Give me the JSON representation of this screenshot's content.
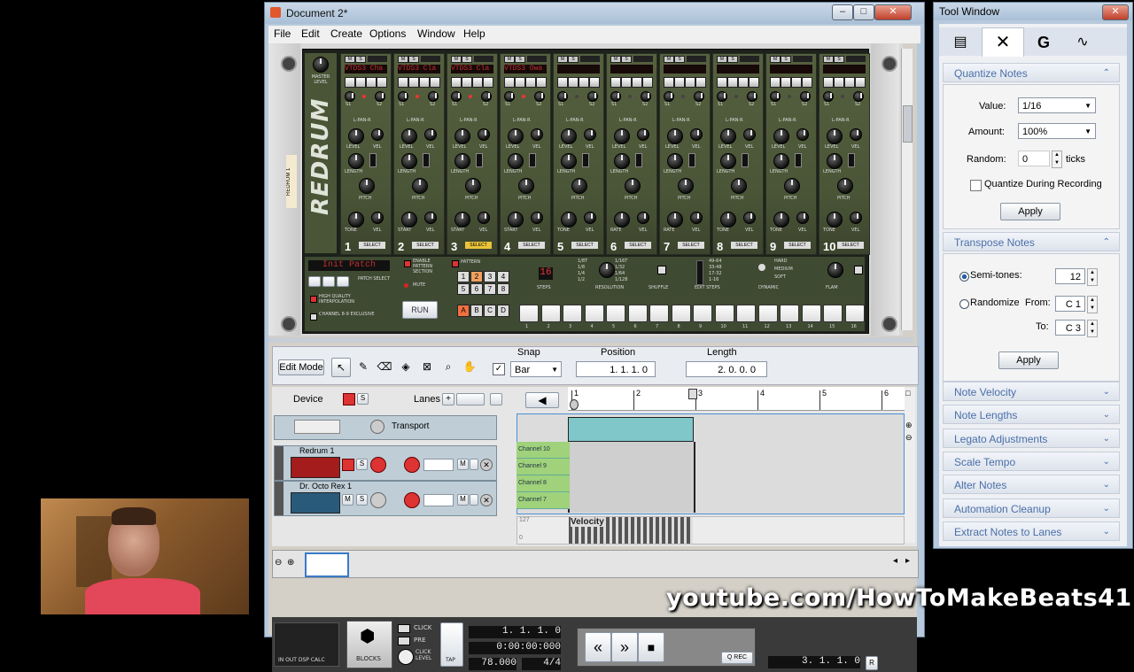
{
  "main_window": {
    "title": "Document 2*",
    "menu": [
      "File",
      "Edit",
      "Create",
      "Options",
      "Window",
      "Help"
    ]
  },
  "redrum": {
    "brand": "REDRUM",
    "device_label": "REDRUM 1",
    "master_label": "MASTER LEVEL",
    "channel_names": [
      "VTDS3 Cha",
      "VTDS3 Cla",
      "VTDS3 Cla",
      "VTDS3 Owa",
      "",
      "",
      "",
      "",
      "",
      ""
    ],
    "channel_numbers": [
      "1",
      "2",
      "3",
      "4",
      "5",
      "6",
      "7",
      "8",
      "9",
      "10"
    ],
    "select_label": "SELECT",
    "knob_labels": {
      "pan": "L-PAN-R",
      "level": "LEVEL",
      "vel": "VEL",
      "length": "LENGTH",
      "pitch": "PITCH",
      "tone": "TONE",
      "start": "START",
      "rate": "RATE",
      "bend": "BEND",
      "s1": "S1",
      "s2": "S2"
    },
    "patch_name": "Init Patch",
    "patch_select": "PATCH SELECT",
    "high_quality": "HIGH QUALITY INTERPOLATION",
    "channel_exclusive": "CHANNEL 8-9 EXCLUSIVE",
    "enable_pattern": "ENABLE PATTERN SECTION",
    "mute": "MUTE",
    "run": "RUN",
    "pattern_label": "PATTERN",
    "pattern_numbers": [
      "1",
      "2",
      "3",
      "4",
      "5",
      "6",
      "7",
      "8"
    ],
    "bank_letters": [
      "A",
      "B",
      "C",
      "D"
    ],
    "steps_value": "16",
    "steps_label": "STEPS",
    "resolution_label": "RESOLUTION",
    "resolution_options": [
      "1/8T",
      "1/8",
      "1/4",
      "1/2",
      "1/16T",
      "1/32",
      "1/64",
      "1/128"
    ],
    "shuffle_label": "SHUFFLE",
    "edit_steps_label": "EDIT STEPS",
    "edit_steps_options": [
      "49-64",
      "33-48",
      "17-32",
      "1-16"
    ],
    "dynamic_label": "DYNAMIC",
    "dynamic_options": [
      "HARD",
      "MEDIUM",
      "SOFT"
    ],
    "flam_label": "FLAM",
    "step_numbers": [
      "1",
      "2",
      "3",
      "4",
      "5",
      "6",
      "7",
      "8",
      "9",
      "10",
      "11",
      "12",
      "13",
      "14",
      "15",
      "16"
    ]
  },
  "sequencer": {
    "edit_mode": "Edit Mode",
    "snap_label": "Snap",
    "snap_value": "Bar",
    "position_label": "Position",
    "position_value": "1. 1. 1.   0",
    "length_label": "Length",
    "length_value": "2. 0. 0.   0",
    "device_label": "Device",
    "lanes_label": "Lanes",
    "ruler": [
      "1",
      "2",
      "3",
      "4",
      "5",
      "6"
    ],
    "tracks": [
      "Transport",
      "Redrum 1",
      "Dr. Octo Rex 1"
    ],
    "channels": [
      "Channel 10",
      "Channel 9",
      "Channel 8",
      "Channel 7"
    ],
    "velocity_label": "Velocity",
    "velocity_max": "127",
    "velocity_min": "0"
  },
  "transport": {
    "click": "CLICK",
    "pre": "PRE",
    "click_level": "CLICK LEVEL",
    "tap": "TAP",
    "blocks": "BLOCKS",
    "meters": "IN OUT DSP CALC",
    "position": "1. 1. 1.   0",
    "time": "0:00:00:000",
    "tempo": "78.000",
    "signature": "4/4",
    "q_rec": "Q REC",
    "loop_pos": "3. 1. 1.   0",
    "r_label": "R"
  },
  "tool_window": {
    "title": "Tool Window",
    "quantize": {
      "title": "Quantize Notes",
      "value_label": "Value:",
      "value": "1/16",
      "amount_label": "Amount:",
      "amount": "100%",
      "random_label": "Random:",
      "random": "0",
      "ticks": "ticks",
      "during_recording": "Quantize During Recording",
      "apply": "Apply"
    },
    "transpose": {
      "title": "Transpose Notes",
      "semitones_label": "Semi-tones:",
      "semitones": "12",
      "randomize_label": "Randomize",
      "from_label": "From:",
      "from": "C 1",
      "to_label": "To:",
      "to": "C 3",
      "apply": "Apply"
    },
    "collapsed_sections": [
      "Note Velocity",
      "Note Lengths",
      "Legato Adjustments",
      "Scale Tempo",
      "Alter Notes",
      "Automation Cleanup",
      "Extract Notes to Lanes"
    ]
  },
  "watermark": "youtube.com/HowToMakeBeats411",
  "colors": {
    "accent_blue": "#4a6fa8",
    "lcd_red": "#c03030",
    "clip_teal": "#7fc7c9",
    "lane_green": "#9fd27b"
  }
}
